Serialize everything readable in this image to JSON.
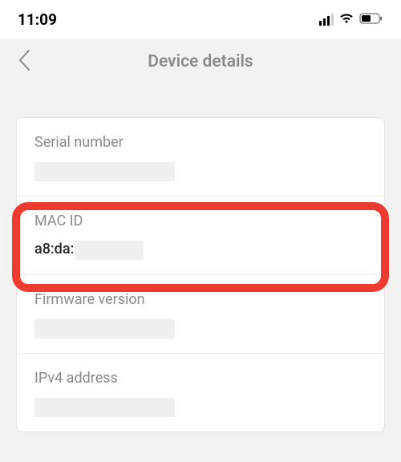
{
  "statusBar": {
    "time": "11:09"
  },
  "nav": {
    "title": "Device details"
  },
  "rows": {
    "serial": {
      "label": "Serial number"
    },
    "mac": {
      "label": "MAC ID",
      "value_prefix": "a8:da:"
    },
    "fw": {
      "label": "Firmware version"
    },
    "ipv4": {
      "label": "IPv4 address"
    }
  },
  "highlight": {
    "color": "#ef3a2f"
  }
}
